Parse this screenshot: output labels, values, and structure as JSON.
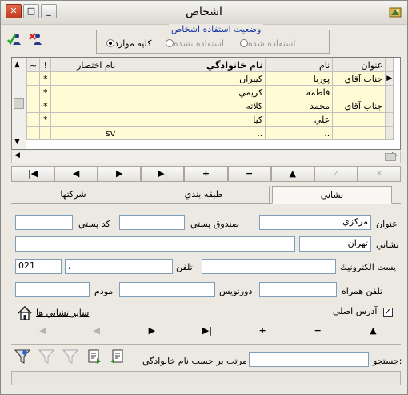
{
  "window": {
    "title": "اشخاص",
    "buttons": {
      "close": "✕",
      "maximize": "□",
      "minimize": "_"
    }
  },
  "filter": {
    "caption": "وضعيت استفاده اشخاص",
    "options": [
      {
        "label": "استفاده شده",
        "checked": false,
        "enabled": false
      },
      {
        "label": "استفاده نشده",
        "checked": false,
        "enabled": false
      },
      {
        "label": "كليه موارد",
        "checked": true,
        "enabled": true
      }
    ]
  },
  "grid": {
    "columns": [
      "عنوان",
      "نام",
      "نام خانوادگي",
      "نام اختصار",
      "!",
      "~"
    ],
    "rows": [
      {
        "title": "جناب آقاي",
        "name": "پوريا",
        "family": "كيبران",
        "short": "",
        "flag": "*"
      },
      {
        "title": "",
        "name": "فاطمه",
        "family": "كريمي",
        "short": "",
        "flag": "*"
      },
      {
        "title": "جناب آقاي",
        "name": "محمد",
        "family": "كلاته",
        "short": "",
        "flag": "*"
      },
      {
        "title": "",
        "name": "علي",
        "family": "كيا",
        "short": "",
        "flag": "*"
      },
      {
        "title": "",
        "name": "..",
        "family": "..",
        "short": "sv",
        "flag": ""
      }
    ]
  },
  "nav_top": [
    "|◀",
    "◀",
    "▶",
    "▶|",
    "+",
    "−",
    "▲",
    "✓",
    "✕"
  ],
  "tabs": [
    "نشاني",
    "طبقه بندي",
    "شركتها"
  ],
  "address": {
    "title_label": "عنوان",
    "title_value": "مركزي",
    "pobox_label": "صندوق پستي",
    "pobox_value": "",
    "postcode_label": "كد پستي",
    "postcode_value": "",
    "address_label": "نشاني",
    "city_value": "تهران",
    "street_value": "",
    "email_label": "پست الكترونيك",
    "email_value": "",
    "phone_label": "تلفن",
    "phone_value": "",
    "phone_ext": ",",
    "area_code": "021",
    "mobile_label": "تلفن همراه",
    "mobile_value": "",
    "fax_label": "دورنويس",
    "fax_value": "",
    "modem_label": "مودم",
    "modem_value": "",
    "main_address_label": "آدرس اصلي",
    "main_address_checked": true,
    "other_addresses_label": "ساير نشاني ها"
  },
  "nav_bottom": [
    "▲",
    "−",
    "+",
    "▶|",
    "▶",
    "◀",
    "|◀"
  ],
  "search": {
    "label": "جستجو:",
    "value": "",
    "sort_label": "مرتب بر حسب نام خانوادگي"
  },
  "colors": {
    "accent": "#1c3aa6",
    "grid_cell": "#fffbd5",
    "window_bg": "#ece9e3"
  }
}
